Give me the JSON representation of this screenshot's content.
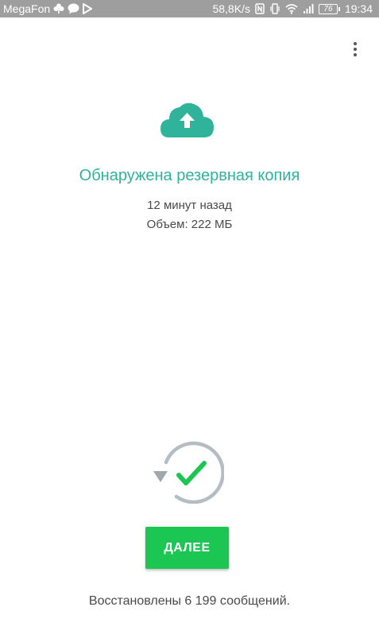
{
  "status_bar": {
    "carrier": "MegaFon",
    "net_speed": "58,8K/s",
    "battery_level": "76",
    "time": "19:34"
  },
  "header": {
    "menu_icon": "more-vert-icon"
  },
  "backup": {
    "icon": "cloud-upload-icon",
    "title": "Обнаружена резервная копия",
    "time_ago": "12 минут назад",
    "size": "Объем: 222 МБ",
    "accent_color": "#2fb39b"
  },
  "restore": {
    "icon": "restore-check-icon",
    "button_label": "ДАЛЕЕ",
    "button_color": "#1bc653",
    "status_text": "Восстановлены 6 199 сообщений."
  }
}
